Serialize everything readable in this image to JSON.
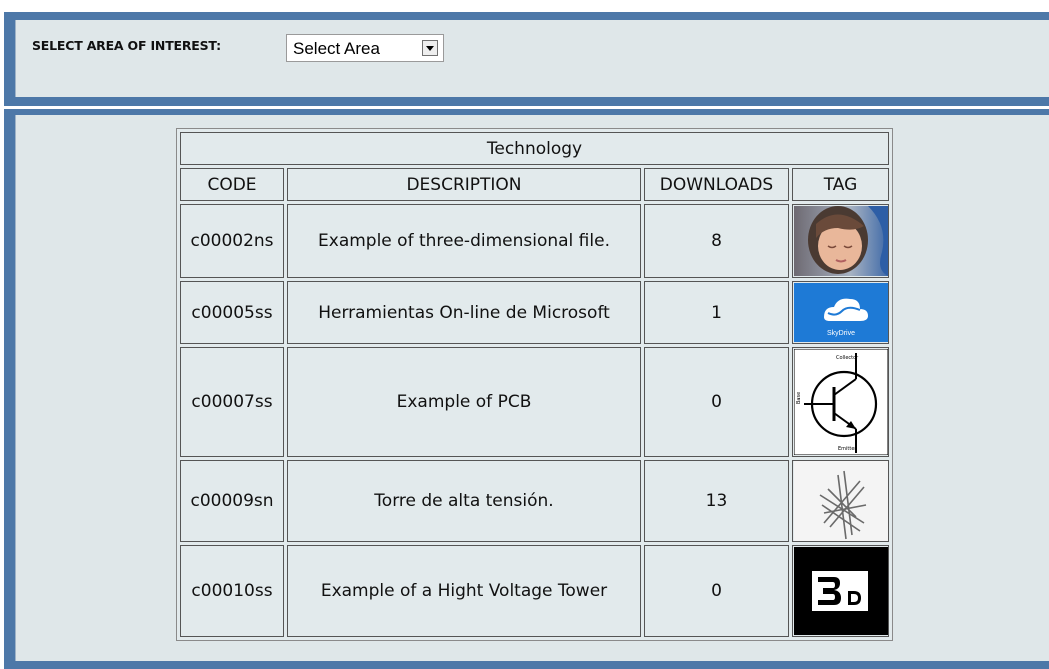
{
  "filter": {
    "label": "SELECT AREA OF INTEREST:",
    "selected": "Select Area"
  },
  "table": {
    "title": "Technology",
    "headers": [
      "CODE",
      "DESCRIPTION",
      "DOWNLOADS",
      "TAG"
    ],
    "rows": [
      {
        "code": "c00002ns",
        "description": "Example of three-dimensional file.",
        "downloads": "8",
        "tag_icon": "child-photo-thumbnail"
      },
      {
        "code": "c00005ss",
        "description": "Herramientas On-line de Microsoft",
        "downloads": "1",
        "tag_icon": "skydrive-logo-thumbnail",
        "tag_text": "SkyDrive"
      },
      {
        "code": "c00007ss",
        "description": "Example of PCB",
        "downloads": "0",
        "tag_icon": "transistor-symbol-thumbnail",
        "tag_labels": [
          "Collector",
          "Base",
          "Emitter"
        ]
      },
      {
        "code": "c00009sn",
        "description": "Torre de alta tensión.",
        "downloads": "13",
        "tag_icon": "tower-sketch-thumbnail"
      },
      {
        "code": "c00010ss",
        "description": "Example of a Hight Voltage Tower",
        "downloads": "0",
        "tag_icon": "3d-logo-thumbnail"
      }
    ]
  },
  "colors": {
    "frame_blue": "#4d78a8",
    "panel_bg": "#dfe7e9",
    "skydrive_blue": "#1e7ad6"
  }
}
